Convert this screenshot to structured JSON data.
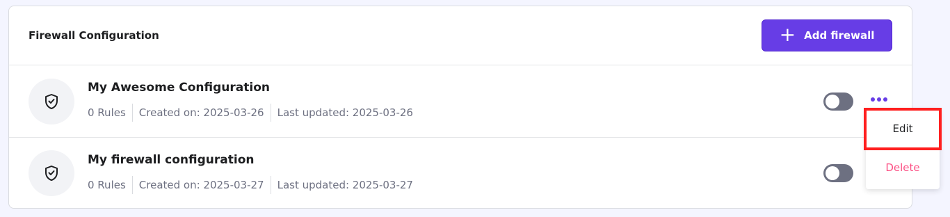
{
  "header": {
    "title": "Firewall Configuration",
    "add_button_icon": "plus-icon",
    "add_button_label": "Add firewall"
  },
  "rows": [
    {
      "title": "My Awesome Configuration",
      "rules": "0 Rules",
      "created": "Created on: 2025-03-26",
      "updated": "Last updated: 2025-03-26",
      "icon": "shield-check-icon",
      "enabled": false
    },
    {
      "title": "My firewall configuration",
      "rules": "0 Rules",
      "created": "Created on: 2025-03-27",
      "updated": "Last updated: 2025-03-27",
      "icon": "shield-check-icon",
      "enabled": false
    }
  ],
  "menu": {
    "edit_label": "Edit",
    "delete_label": "Delete"
  },
  "colors": {
    "accent": "#673de6",
    "danger": "#fc5185",
    "highlight": "#ff1f1f",
    "toggle_off": "#6d7081"
  }
}
